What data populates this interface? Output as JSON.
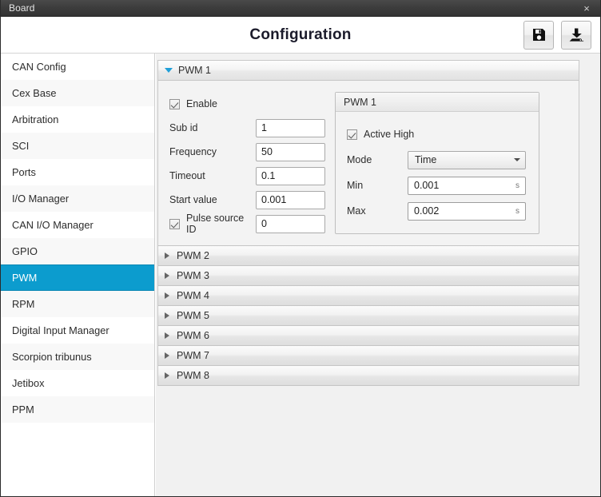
{
  "window": {
    "title": "Board",
    "close_label": "×"
  },
  "header": {
    "title": "Configuration",
    "actions": [
      {
        "name": "save-button",
        "icon": "floppy-disk-icon",
        "label": "Save"
      },
      {
        "name": "import-button",
        "icon": "download-icon",
        "label": "Download"
      }
    ]
  },
  "sidebar": {
    "items": [
      {
        "label": "CAN Config",
        "selected": false
      },
      {
        "label": "Cex Base",
        "selected": false
      },
      {
        "label": "Arbitration",
        "selected": false
      },
      {
        "label": "SCI",
        "selected": false
      },
      {
        "label": "Ports",
        "selected": false
      },
      {
        "label": "I/O Manager",
        "selected": false
      },
      {
        "label": "CAN I/O Manager",
        "selected": false
      },
      {
        "label": "GPIO",
        "selected": false
      },
      {
        "label": "PWM",
        "selected": true
      },
      {
        "label": "RPM",
        "selected": false
      },
      {
        "label": "Digital Input Manager",
        "selected": false
      },
      {
        "label": "Scorpion tribunus",
        "selected": false
      },
      {
        "label": "Jetibox",
        "selected": false
      },
      {
        "label": "PPM",
        "selected": false
      }
    ]
  },
  "accordion": {
    "sections": [
      {
        "label": "PWM 1",
        "expanded": true
      },
      {
        "label": "PWM 2",
        "expanded": false
      },
      {
        "label": "PWM 3",
        "expanded": false
      },
      {
        "label": "PWM 4",
        "expanded": false
      },
      {
        "label": "PWM 5",
        "expanded": false
      },
      {
        "label": "PWM 6",
        "expanded": false
      },
      {
        "label": "PWM 7",
        "expanded": false
      },
      {
        "label": "PWM 8",
        "expanded": false
      }
    ]
  },
  "pwm1": {
    "enable": {
      "label": "Enable",
      "checked": true
    },
    "sub_id": {
      "label": "Sub id",
      "value": "1"
    },
    "frequency": {
      "label": "Frequency",
      "value": "50"
    },
    "timeout": {
      "label": "Timeout",
      "value": "0.1"
    },
    "start_value": {
      "label": "Start value",
      "value": "0.001"
    },
    "pulse_source_id": {
      "label": "Pulse source ID",
      "checked": true,
      "value": "0"
    },
    "group": {
      "title": "PWM 1",
      "active_high": {
        "label": "Active High",
        "checked": true
      },
      "mode": {
        "label": "Mode",
        "value": "Time"
      },
      "min": {
        "label": "Min",
        "value": "0.001",
        "unit": "s"
      },
      "max": {
        "label": "Max",
        "value": "0.002",
        "unit": "s"
      }
    }
  },
  "colors": {
    "accent": "#0c9cce",
    "expand_arrow": "#1f9fd8",
    "titlebar": "#3c3c3c",
    "panel_bg": "#f1f1f1"
  }
}
